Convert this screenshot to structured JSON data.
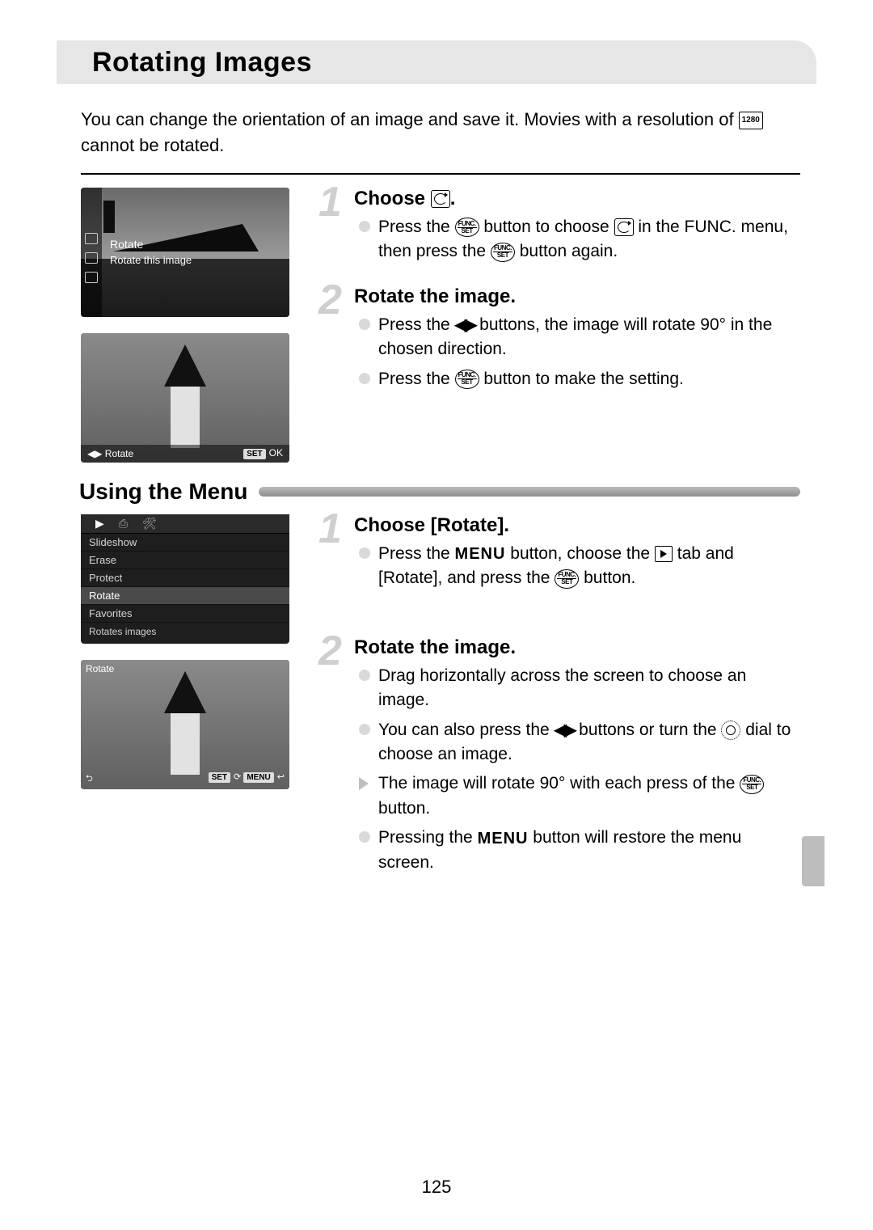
{
  "title": "Rotating Images",
  "intro_part1": "You can change the orientation of an image and save it. Movies with a resolution of ",
  "intro_part2": " cannot be rotated.",
  "thumb1": {
    "label": "Rotate",
    "hint": "Rotate this image"
  },
  "thumb2": {
    "left": "Rotate",
    "ok": "OK"
  },
  "step1": {
    "num": "1",
    "heading_pre": "Choose ",
    "b1_a": "Press the ",
    "b1_b": " button to choose ",
    "b1_c": " in the FUNC. menu, then press the ",
    "b1_d": " button again."
  },
  "step2": {
    "num": "2",
    "heading": "Rotate the image.",
    "b1_a": "Press the ",
    "b1_b": " buttons, the image will rotate 90° in the chosen direction.",
    "b2_a": "Press the ",
    "b2_b": " button to make the setting."
  },
  "section2": "Using the Menu",
  "menu": {
    "items": [
      "Slideshow",
      "Erase",
      "Protect",
      "Rotate",
      "Favorites"
    ],
    "hint": "Rotates images"
  },
  "thumb3": {
    "title": "Rotate",
    "bl": "⮌",
    "br": "SET ⟳ MENU ↩"
  },
  "step3": {
    "num": "1",
    "heading": "Choose [Rotate].",
    "b1_a": "Press the ",
    "b1_b": " button, choose the ",
    "b1_c": " tab and [Rotate], and press the ",
    "b1_d": " button."
  },
  "step4": {
    "num": "2",
    "heading": "Rotate the image.",
    "b1": "Drag horizontally across the screen to choose an image.",
    "b2_a": "You can also press the ",
    "b2_b": " buttons or turn the ",
    "b2_c": " dial to choose an image.",
    "b3_a": "The image will rotate 90° with each press of the ",
    "b3_b": " button.",
    "b4_a": "Pressing the ",
    "b4_b": " button will restore the menu screen."
  },
  "page_number": "125",
  "glyphs": {
    "func": "FUNC.",
    "set": "SET",
    "menu": "MENU",
    "res": "1280",
    "lr": "◀▶"
  }
}
